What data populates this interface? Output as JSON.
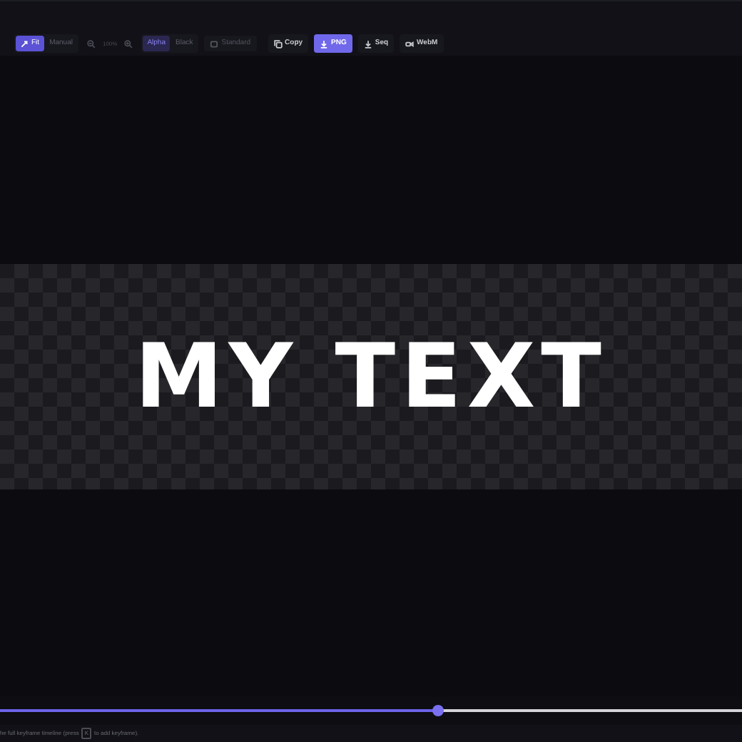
{
  "toolbar": {
    "fit_modes": [
      {
        "label": "Fit",
        "selected": true
      },
      {
        "label": "Manual",
        "selected": false
      }
    ],
    "zoom": "100%",
    "backgrounds": [
      {
        "label": "Alpha",
        "selected": true
      },
      {
        "label": "Black",
        "selected": false
      }
    ],
    "quality": "Standard",
    "actions": [
      {
        "label": "Copy",
        "kind": "copy",
        "primary": false
      },
      {
        "label": "PNG",
        "kind": "download",
        "primary": true
      },
      {
        "label": "Seq",
        "kind": "download",
        "primary": false
      },
      {
        "label": "WebM",
        "kind": "video",
        "primary": false
      }
    ]
  },
  "preview": {
    "text": "MY TEXT"
  },
  "timeline": {
    "level": 0.59
  },
  "hint": {
    "before": "he full keyframe timeline (press",
    "key": "K",
    "after": "to add keyframe)."
  }
}
